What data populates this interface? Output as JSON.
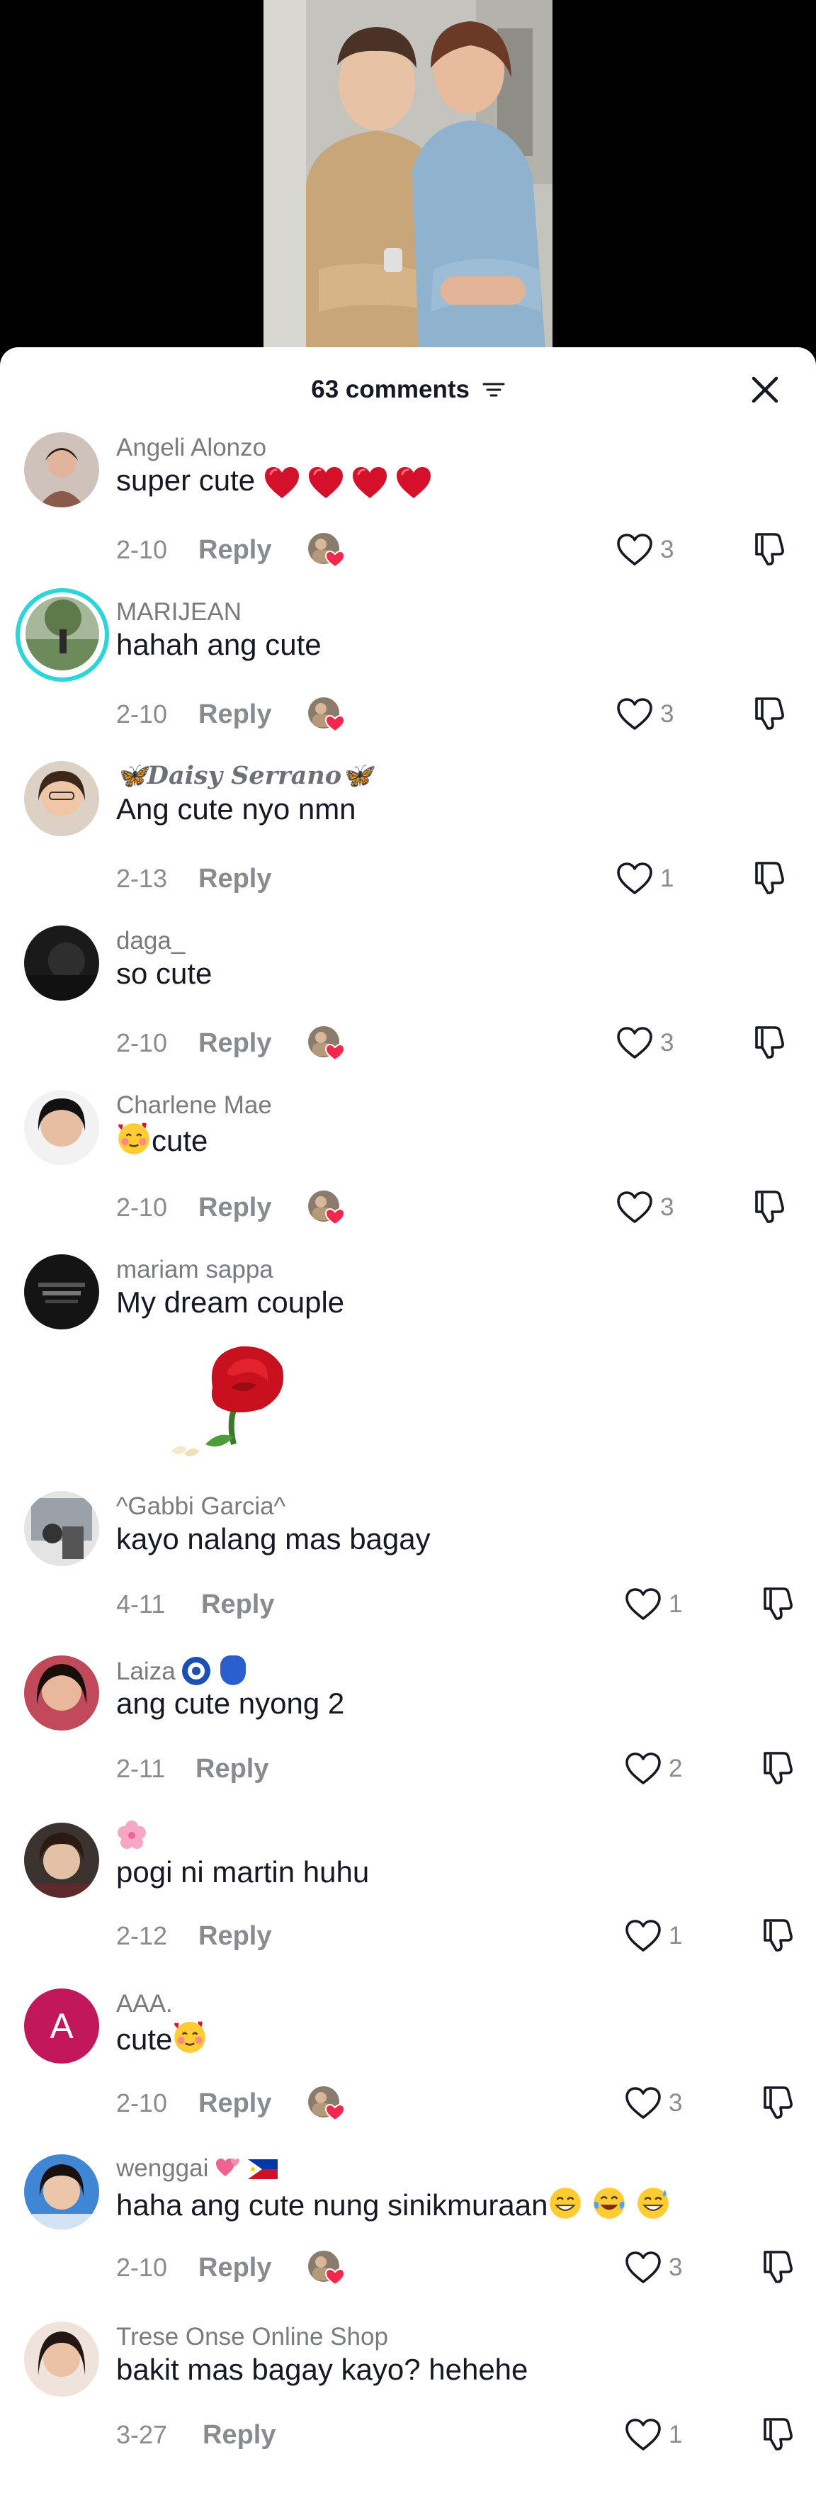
{
  "sheet": {
    "comment_count_label": "63 comments"
  },
  "comments": [
    {
      "username": "Angeli Alonzo",
      "text": "super cute ",
      "date": "2-10",
      "reply": "Reply",
      "likes": "3",
      "creator_liked": true
    },
    {
      "username": "MARIJEAN",
      "text": "hahah ang cute",
      "date": "2-10",
      "reply": "Reply",
      "likes": "3",
      "creator_liked": true
    },
    {
      "username": "Daisy Serrano",
      "text": "Ang cute nyo nmn",
      "date": "2-13",
      "reply": "Reply",
      "likes": "1",
      "creator_liked": false
    },
    {
      "username": "daga_",
      "text": "so cute",
      "date": "2-10",
      "reply": "Reply",
      "likes": "3",
      "creator_liked": true
    },
    {
      "username": "Charlene Mae",
      "text": "cute",
      "date": "2-10",
      "reply": "Reply",
      "likes": "3",
      "creator_liked": true
    },
    {
      "username": "mariam sappa",
      "text": "My dream couple",
      "sticker": "red-rose-sticker"
    },
    {
      "username": "^Gabbi Garcia^",
      "text": "kayo nalang mas bagay",
      "date": "4-11",
      "reply": "Reply",
      "likes": "1",
      "creator_liked": false
    },
    {
      "username": "Laiza",
      "text": "ang cute nyong 2",
      "date": "2-11",
      "reply": "Reply",
      "likes": "2",
      "creator_liked": false
    },
    {
      "username": "",
      "text": "pogi ni martin huhu",
      "date": "2-12",
      "reply": "Reply",
      "likes": "1",
      "creator_liked": false
    },
    {
      "username": "AAA.",
      "avatar_letter": "A",
      "text": "cute",
      "date": "2-10",
      "reply": "Reply",
      "likes": "3",
      "creator_liked": true
    },
    {
      "username": "wenggai",
      "text": "haha ang cute nung sinikmuraan",
      "date": "2-10",
      "reply": "Reply",
      "likes": "3",
      "creator_liked": true
    },
    {
      "username": "Trese Onse Online Shop",
      "text": "bakit mas bagay kayo? hehehe",
      "date": "3-27",
      "reply": "Reply",
      "likes": "1",
      "creator_liked": false
    }
  ],
  "colors": {
    "text_primary": "#161823",
    "text_secondary": "#8a8b91",
    "story_ring": "#2bd5d8",
    "heart_red": "#e0102a",
    "letter_avatar": "#c2185b"
  },
  "icons": [
    "sort-icon",
    "close-icon",
    "heart-outline-icon",
    "thumbs-down-icon",
    "creator-liked-icon"
  ]
}
